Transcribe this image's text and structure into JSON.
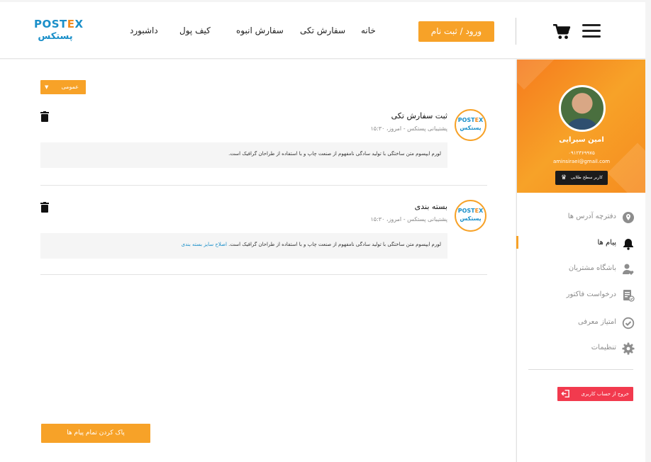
{
  "header": {
    "logo_text": "POSTEX",
    "logo_text_fa": "پستکس",
    "nav": {
      "home": "خانه",
      "single_order": "سفارش تکی",
      "bulk_order": "سفارش انبوه",
      "wallet": "کیف پول",
      "dashboard": "داشبورد"
    },
    "login_button": "ورود / ثبت نام",
    "icons": {
      "cart": "cart-icon",
      "menu": "hamburger-menu-icon"
    }
  },
  "main": {
    "filter": {
      "selected": "عمومی"
    },
    "messages": [
      {
        "avatar_text": "POSTEX",
        "avatar_text_fa": "پستکس",
        "title": "ثبت سفارش تکی",
        "meta": "پشتیبانی پستکس - امروز، ۱۵:۳۰",
        "body": "لورم ایپسوم متن ساختگی با تولید سادگی نامفهوم از صنعت چاپ و با استفاده از طراحان گرافیک است.",
        "link": ""
      },
      {
        "avatar_text": "POSTEX",
        "avatar_text_fa": "پستکس",
        "title": "بسته بندی",
        "meta": "پشتیبانی پستکس - امروز، ۱۵:۳۰",
        "body": "لورم ایپسوم متن ساختگی با تولید سادگی نامفهوم از صنعت چاپ و با استفاده از طراحان گرافیک است.",
        "link": "اصلاح سایز بسته بندی"
      }
    ],
    "clear_all_button": "پاک کردن تمام پیام ها"
  },
  "sidebar": {
    "profile": {
      "name": "امین سیرایی",
      "phone": "۰۹۱۲۳۶۹۹۷۵",
      "email": "aminsiraei@gmail.com",
      "level": "کاربر سطح طلایی"
    },
    "items": [
      {
        "label": "دفترچه آدرس ها",
        "icon": "location-pin-icon",
        "active": false
      },
      {
        "label": "پیام ها",
        "icon": "bell-icon",
        "active": true
      },
      {
        "label": "باشگاه مشتریان",
        "icon": "user-heart-icon",
        "active": false
      },
      {
        "label": "درخواست فاکتور",
        "icon": "invoice-icon",
        "active": false
      },
      {
        "label": "امتیاز معرفی",
        "icon": "check-circle-icon",
        "active": false
      },
      {
        "label": "تنظیمات",
        "icon": "gear-icon",
        "active": false
      }
    ],
    "logout_button": "خروج از حساب کاربری"
  },
  "colors": {
    "accent": "#f7a228",
    "brand_blue": "#1a8fc9",
    "logout_red": "#f23a4e"
  }
}
